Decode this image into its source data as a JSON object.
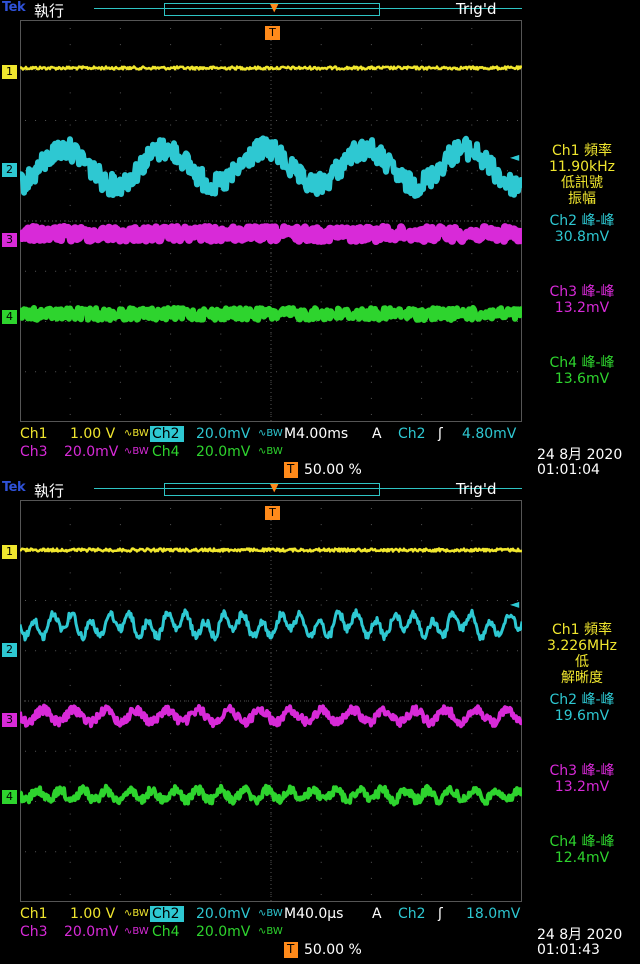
{
  "colors": {
    "ch1": "#f0e62e",
    "ch2": "#2ec8d2",
    "ch3": "#d82ad8",
    "ch4": "#2ed42e",
    "grid": "#555555",
    "trigger": "#ff8a1a",
    "bg": "#000000",
    "logo": "#2f52d8"
  },
  "screens": [
    {
      "logo": "Tek",
      "mode": "執行",
      "status": "Trig'd",
      "markers": {
        "ch1": "1",
        "ch2": "2",
        "ch3": "3",
        "ch4": "4",
        "trigger": "T"
      },
      "measure": {
        "ch1_title": "Ch1 頻率",
        "ch1_value": "11.90kHz",
        "ch1_note1": "低訊號",
        "ch1_note2": "振幅",
        "ch2_title": "Ch2 峰-峰",
        "ch2_value": "30.8mV",
        "ch3_title": "Ch3 峰-峰",
        "ch3_value": "13.2mV",
        "ch4_title": "Ch4 峰-峰",
        "ch4_value": "13.6mV"
      },
      "settings": {
        "ch1_label": "Ch1",
        "ch1_scale": "1.00 V",
        "ch1_coupling": "∿BW",
        "ch2_label": "Ch2",
        "ch2_scale": "20.0mV",
        "ch2_coupling": "∿BW",
        "ch3_label": "Ch3",
        "ch3_scale": "20.0mV",
        "ch3_coupling": "∿BW",
        "ch4_label": "Ch4",
        "ch4_scale": "20.0mV",
        "ch4_coupling": "∿BW",
        "timebase": "M4.00ms",
        "trig_mode": "A",
        "trig_source": "Ch2",
        "trig_slope": "ʃ",
        "trig_level": "4.80mV",
        "trig_position": "50.00 %"
      },
      "date": "24 8月  2020",
      "time": "01:01:04"
    },
    {
      "logo": "Tek",
      "mode": "執行",
      "status": "Trig'd",
      "markers": {
        "ch1": "1",
        "ch2": "2",
        "ch3": "3",
        "ch4": "4",
        "trigger": "T"
      },
      "measure": {
        "ch1_title": "Ch1 頻率",
        "ch1_value": "3.226MHz",
        "ch1_note1": "低",
        "ch1_note2": "解晰度",
        "ch2_title": "Ch2 峰-峰",
        "ch2_value": "19.6mV",
        "ch3_title": "Ch3 峰-峰",
        "ch3_value": "13.2mV",
        "ch4_title": "Ch4 峰-峰",
        "ch4_value": "12.4mV"
      },
      "settings": {
        "ch1_label": "Ch1",
        "ch1_scale": "1.00 V",
        "ch1_coupling": "∿BW",
        "ch2_label": "Ch2",
        "ch2_scale": "20.0mV",
        "ch2_coupling": "∿BW",
        "ch3_label": "Ch3",
        "ch3_scale": "20.0mV",
        "ch3_coupling": "∿BW",
        "ch4_label": "Ch4",
        "ch4_scale": "20.0mV",
        "ch4_coupling": "∿BW",
        "timebase": "M40.0µs",
        "trig_mode": "A",
        "trig_source": "Ch2",
        "trig_slope": "ʃ",
        "trig_level": "18.0mV",
        "trig_position": "50.00 %"
      },
      "date": "24 8月  2020",
      "time": "01:01:43"
    }
  ]
}
